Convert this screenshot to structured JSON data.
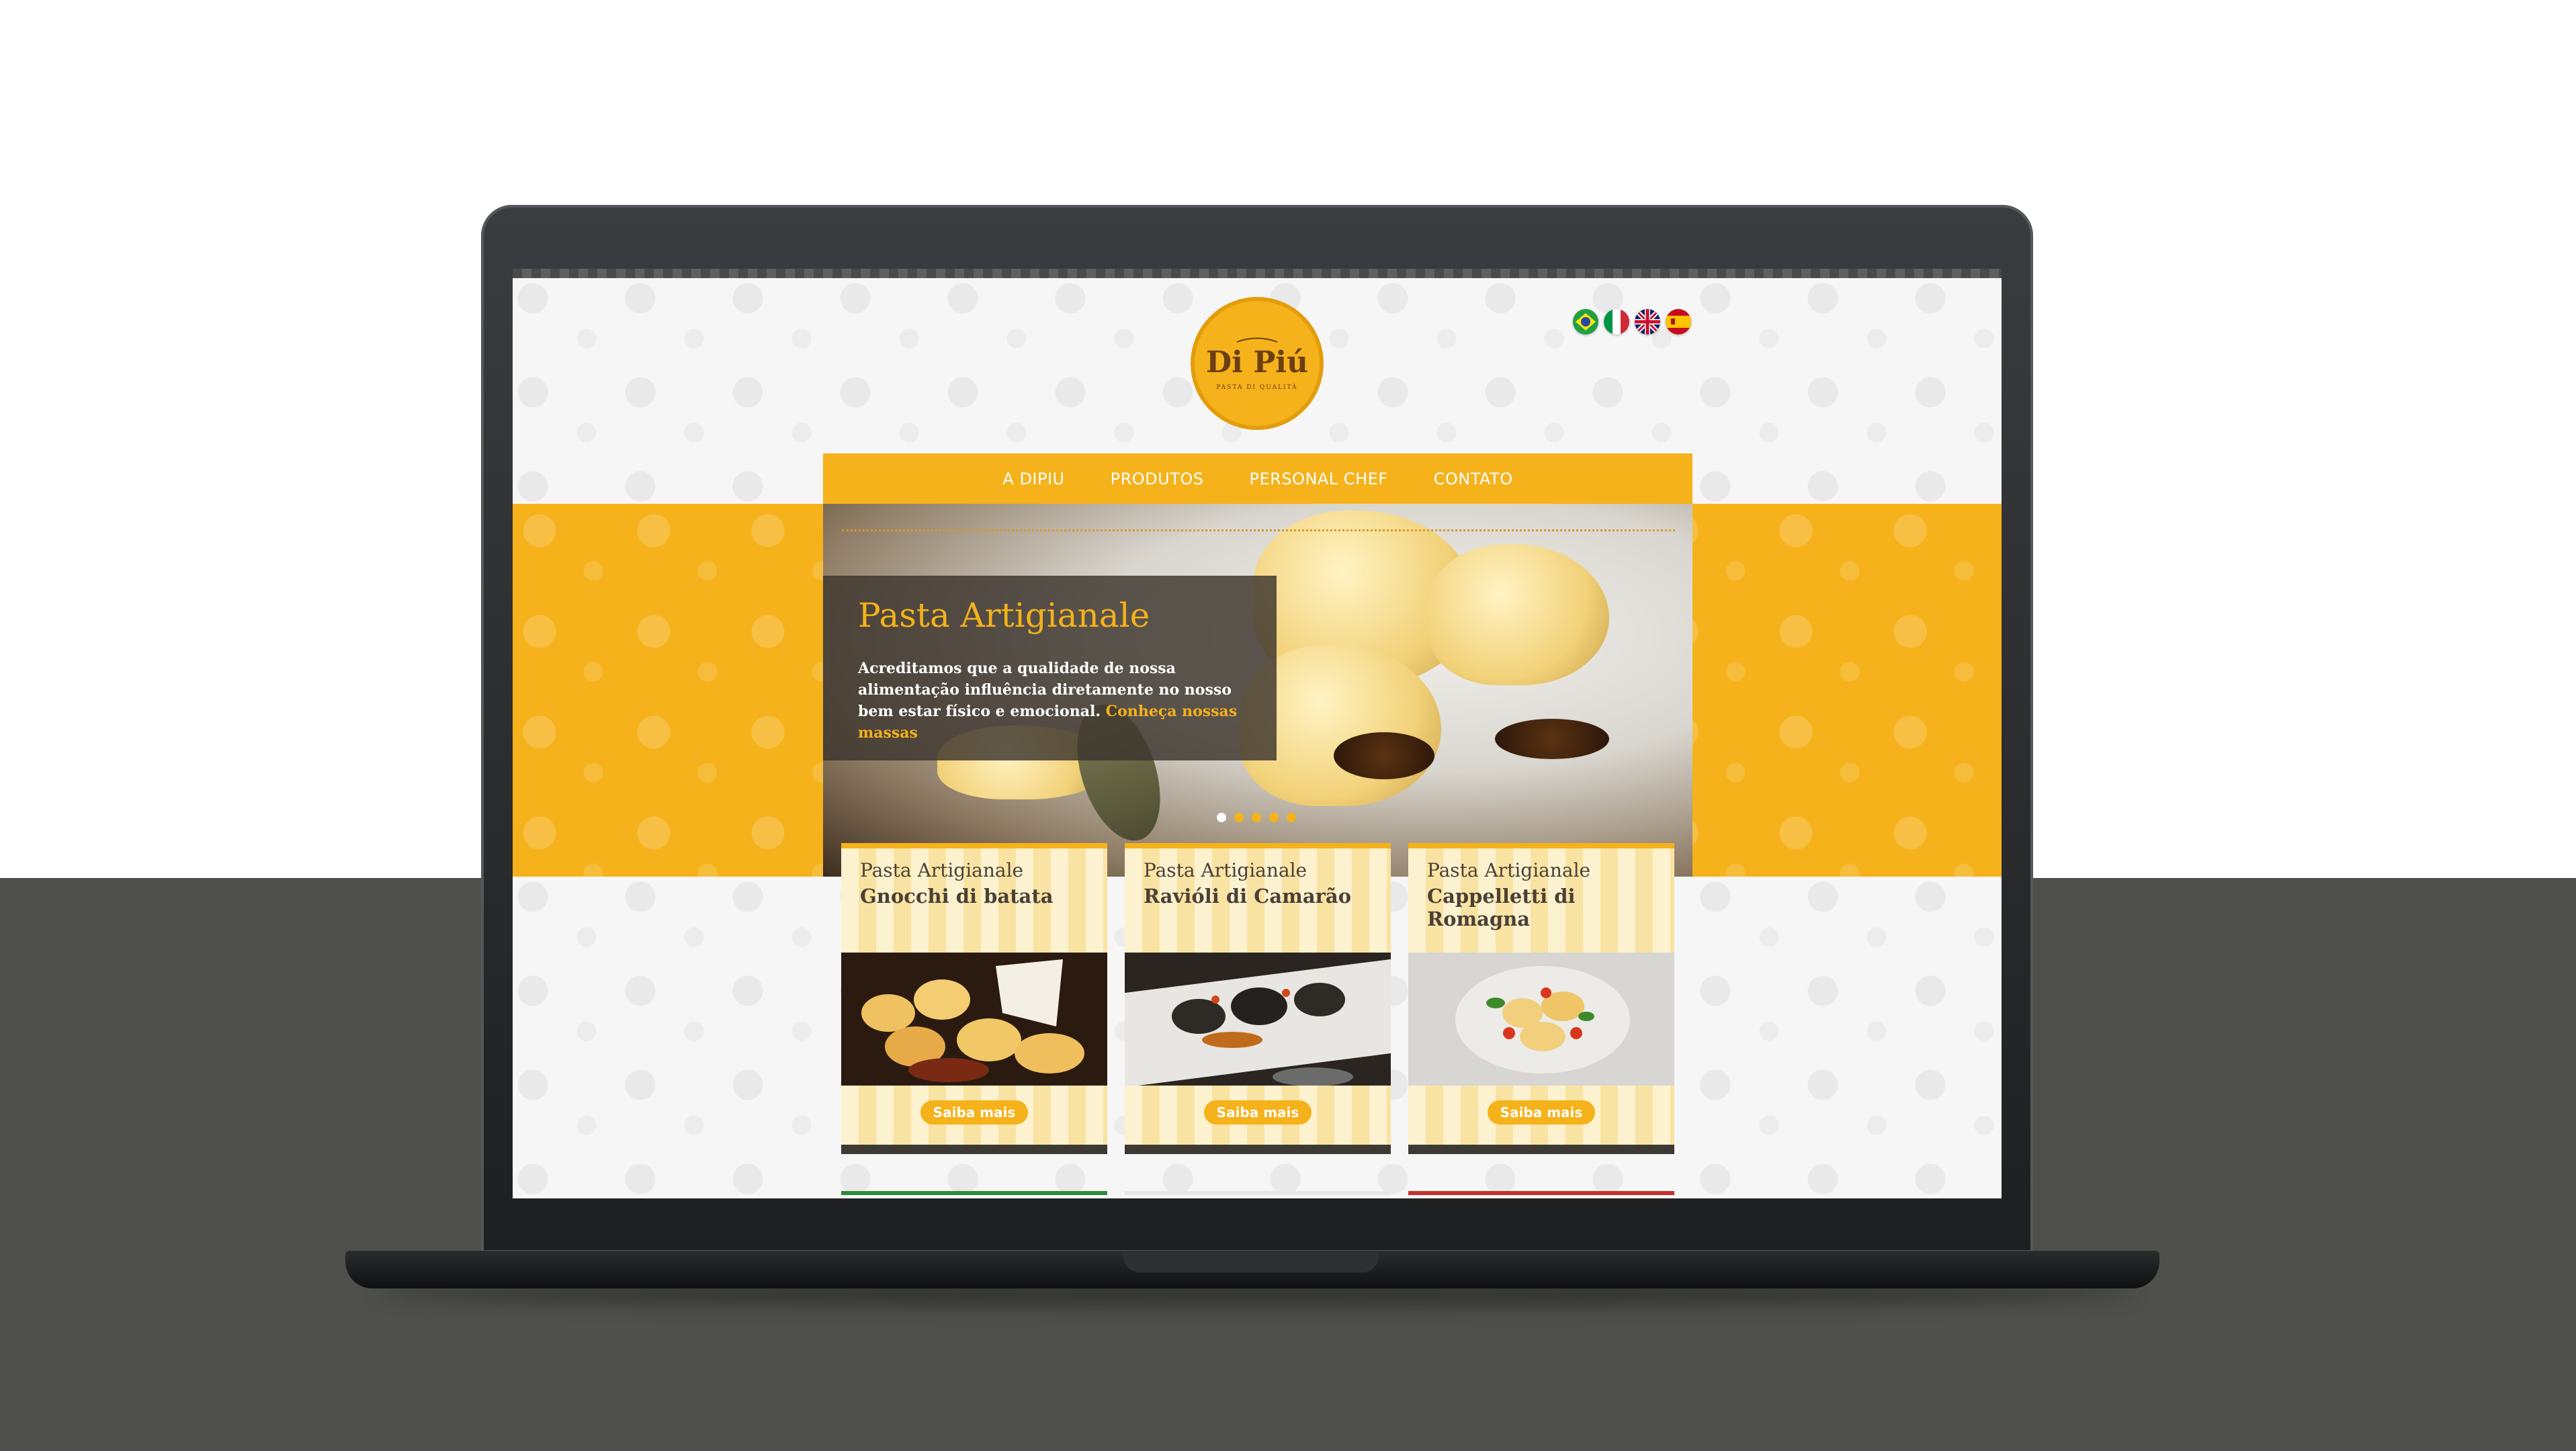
{
  "site": {
    "logo": {
      "name": "Di Piú",
      "tagline": "PASTA DI QUALITÀ"
    },
    "languages": [
      {
        "code": "pt",
        "icon": "brazil-flag-icon"
      },
      {
        "code": "it",
        "icon": "italy-flag-icon"
      },
      {
        "code": "en",
        "icon": "uk-flag-icon"
      },
      {
        "code": "es",
        "icon": "spain-flag-icon"
      }
    ],
    "nav": [
      "A DIPIU",
      "PRODUTOS",
      "PERSONAL CHEF",
      "CONTATO"
    ]
  },
  "hero": {
    "title": "Pasta Artigianale",
    "text": "Acreditamos que a qualidade de nossa alimentação influência diretamente no nosso bem estar físico e emocional.",
    "link": "Conheça nossas massas",
    "slides": 5,
    "active_slide": 1
  },
  "cards": [
    {
      "category": "Pasta Artigianale",
      "name": "Gnocchi di batata",
      "button": "Saiba mais"
    },
    {
      "category": "Pasta Artigianale",
      "name": "Ravióli di Camarão",
      "button": "Saiba mais"
    },
    {
      "category": "Pasta Artigianale",
      "name": "Cappelletti di Romagna",
      "button": "Saiba mais"
    }
  ],
  "colors": {
    "brand": "#f5b21b",
    "dark": "#4a4036",
    "frame": "#1d1f21"
  }
}
